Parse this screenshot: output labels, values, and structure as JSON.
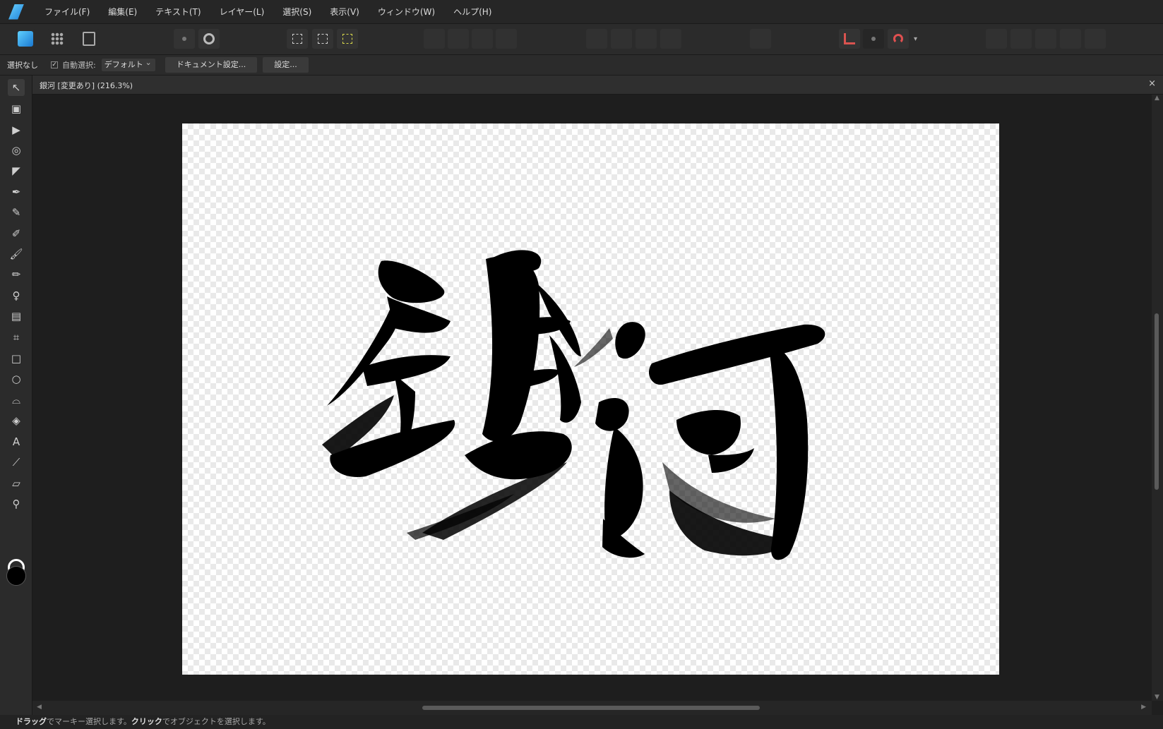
{
  "menu": [
    "ファイル(F)",
    "編集(E)",
    "テキスト(T)",
    "レイヤー(L)",
    "選択(S)",
    "表示(V)",
    "ウィンドウ(W)",
    "ヘルプ(H)"
  ],
  "context": {
    "selection": "選択なし",
    "auto_select_label": "自動選択:",
    "auto_select_value": "デフォルト",
    "document_settings": "ドキュメント設定...",
    "settings": "設定..."
  },
  "document": {
    "title": "銀河 [変更あり] (216.3%)",
    "close_glyph": "×"
  },
  "status": {
    "drag_word": "ドラッグ",
    "drag_rest": "でマーキー選択します。",
    "click_word": "クリック",
    "click_rest": "でオブジェクトを選択します。"
  },
  "tools": [
    {
      "icon": "move-tool-icon",
      "glyph": "↖"
    },
    {
      "icon": "artboard-tool-icon",
      "glyph": "▣"
    },
    {
      "icon": "node-tool-icon",
      "glyph": "▶"
    },
    {
      "icon": "corner-tool-icon",
      "glyph": "◎"
    },
    {
      "icon": "point-transform-icon",
      "glyph": "◤"
    },
    {
      "icon": "pen-tool-icon",
      "glyph": "✒"
    },
    {
      "icon": "pencil-tool-icon",
      "glyph": "✎"
    },
    {
      "icon": "vector-brush-icon",
      "glyph": "✐"
    },
    {
      "icon": "paint-brush-icon",
      "glyph": "🖌"
    },
    {
      "icon": "fill-tool-icon",
      "glyph": "✏"
    },
    {
      "icon": "transparency-tool-icon",
      "glyph": "♀"
    },
    {
      "icon": "place-image-icon",
      "glyph": "▤"
    },
    {
      "icon": "crop-tool-icon",
      "glyph": "⌗"
    },
    {
      "icon": "rectangle-tool-icon",
      "glyph": "□"
    },
    {
      "icon": "ellipse-tool-icon",
      "glyph": "○"
    },
    {
      "icon": "rounded-rect-icon",
      "glyph": "⌓"
    },
    {
      "icon": "shape-builder-icon",
      "glyph": "◈"
    },
    {
      "icon": "text-tool-icon",
      "glyph": "A"
    },
    {
      "icon": "color-picker-icon",
      "glyph": "⟋"
    },
    {
      "icon": "measure-tool-icon",
      "glyph": "▱"
    },
    {
      "icon": "zoom-tool-icon",
      "glyph": "⚲"
    }
  ],
  "colors": {
    "accent": "#2f8fe0",
    "snap": "#d9534f"
  }
}
